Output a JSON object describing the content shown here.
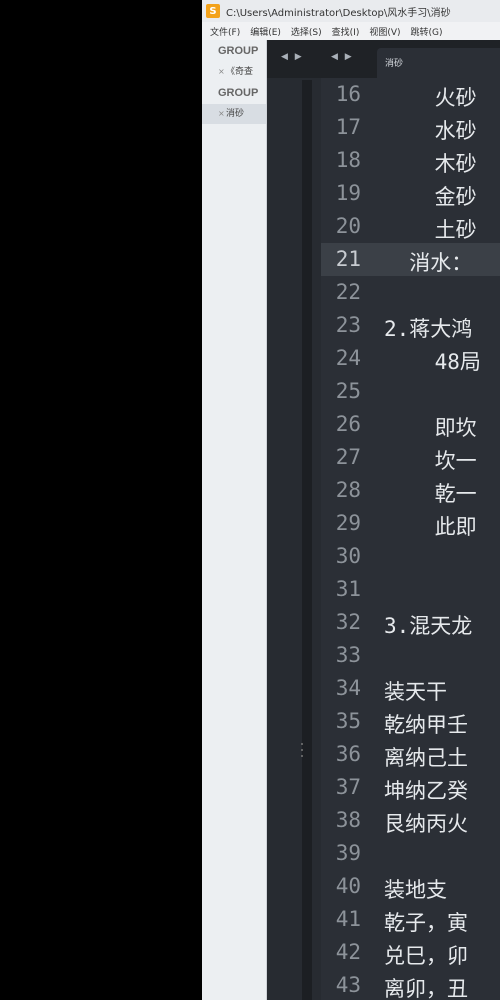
{
  "window": {
    "title": "C:\\Users\\Administrator\\Desktop\\风水手习\\消砂"
  },
  "menu": [
    "文件(F)",
    "编辑(E)",
    "选择(S)",
    "查找(I)",
    "视图(V)",
    "跳转(G)"
  ],
  "sidebar": {
    "groups": [
      {
        "label": "GROUP",
        "files": [
          {
            "name": "《奇查",
            "active": false
          }
        ]
      },
      {
        "label": "GROUP",
        "files": [
          {
            "name": "消砂",
            "active": true
          }
        ]
      }
    ]
  },
  "tabs": {
    "nav_left": "◀ ▶",
    "nav_right": "◀ ▶",
    "active_label": "消砂"
  },
  "editor": {
    "current_line": 21,
    "lines": [
      {
        "n": "16",
        "text": "    火砂"
      },
      {
        "n": "17",
        "text": "    水砂"
      },
      {
        "n": "18",
        "text": "    木砂"
      },
      {
        "n": "19",
        "text": "    金砂"
      },
      {
        "n": "20",
        "text": "    土砂"
      },
      {
        "n": "21",
        "text": "  消水："
      },
      {
        "n": "22",
        "text": ""
      },
      {
        "n": "23",
        "text": "2.蒋大鸿"
      },
      {
        "n": "24",
        "text": "    48局"
      },
      {
        "n": "25",
        "text": ""
      },
      {
        "n": "26",
        "text": "    即坎"
      },
      {
        "n": "27",
        "text": "    坎一"
      },
      {
        "n": "28",
        "text": "    乾一"
      },
      {
        "n": "29",
        "text": "    此即"
      },
      {
        "n": "30",
        "text": ""
      },
      {
        "n": "31",
        "text": ""
      },
      {
        "n": "32",
        "text": "3.混天龙"
      },
      {
        "n": "33",
        "text": ""
      },
      {
        "n": "34",
        "text": "装天干"
      },
      {
        "n": "35",
        "text": "乾纳甲壬"
      },
      {
        "n": "36",
        "text": "离纳己土"
      },
      {
        "n": "37",
        "text": "坤纳乙癸"
      },
      {
        "n": "38",
        "text": "艮纳丙火"
      },
      {
        "n": "39",
        "text": ""
      },
      {
        "n": "40",
        "text": "装地支"
      },
      {
        "n": "41",
        "text": "乾子，寅"
      },
      {
        "n": "42",
        "text": "兑巳，卯"
      },
      {
        "n": "43",
        "text": "离卯，丑"
      }
    ]
  }
}
